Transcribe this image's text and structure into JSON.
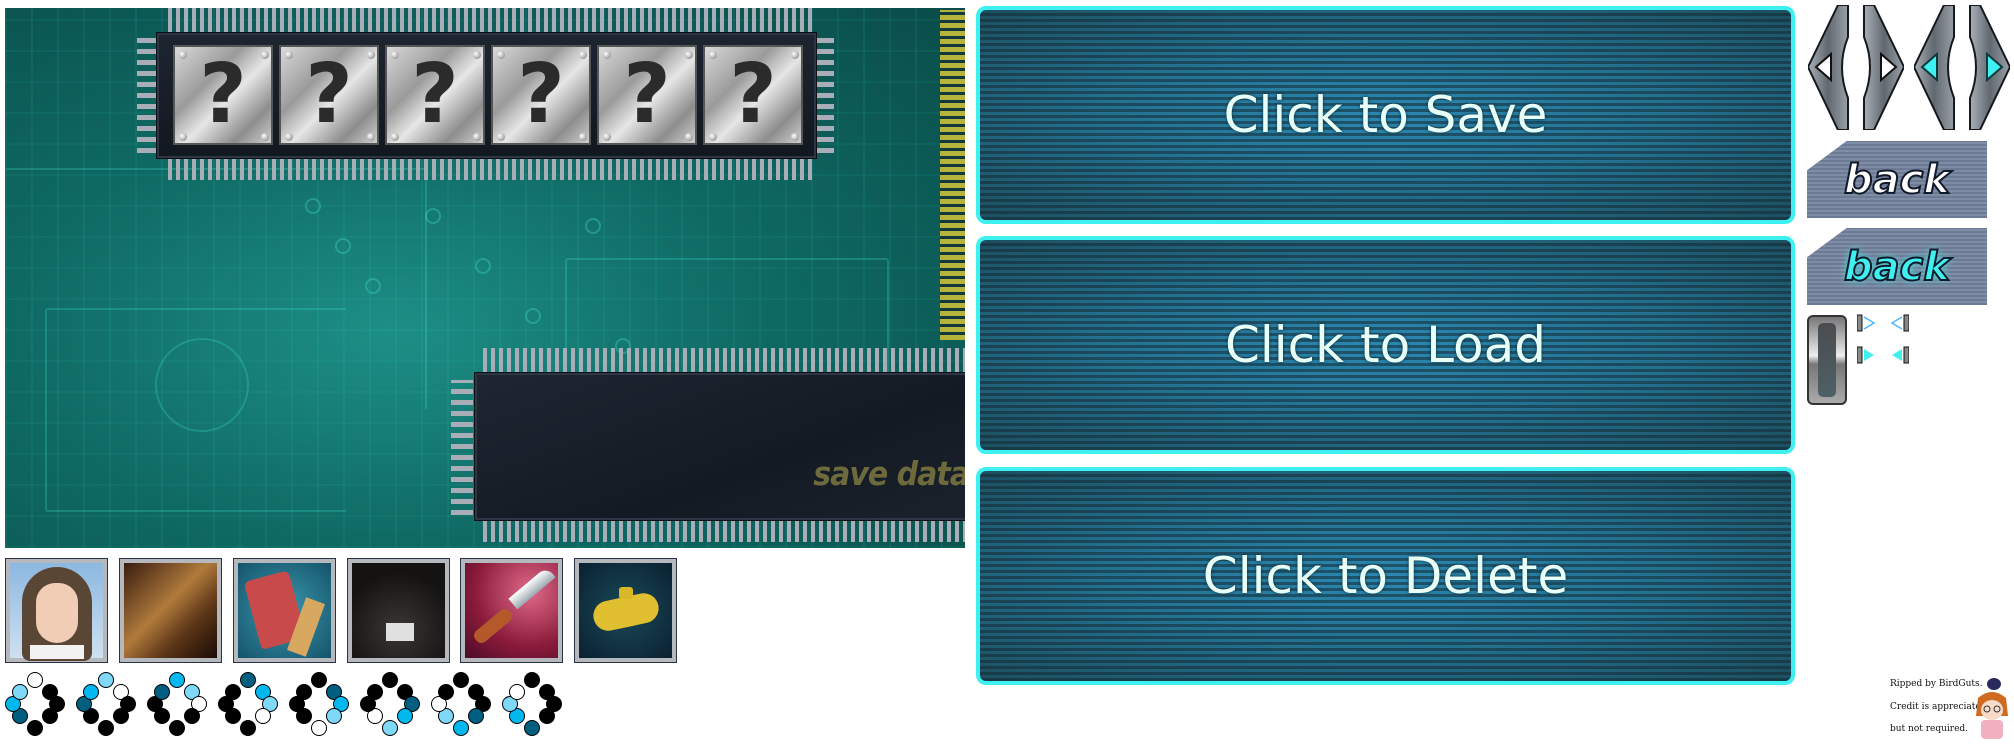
{
  "save_screen": {
    "slot_placeholders": [
      "?",
      "?",
      "?",
      "?",
      "?",
      "?"
    ],
    "title": "save data"
  },
  "actions": {
    "save": "Click to Save",
    "load": "Click to Load",
    "delete": "Click to Delete"
  },
  "navigation": {
    "arrows_normal_icon": "left-right-arrows-icon",
    "arrows_highlighted_icon": "left-right-arrows-highlighted-icon",
    "back_normal": "back",
    "back_highlighted": "back"
  },
  "colors": {
    "accent_cyan": "#3ff0f0",
    "button_blue": "#2b88b0",
    "circuit_teal": "#0f6a64",
    "back_highlight": "#3ff0f0"
  },
  "thumbnails": [
    {
      "icon": "girl-portrait"
    },
    {
      "icon": "coffin"
    },
    {
      "icon": "axe"
    },
    {
      "icon": "empty-safe"
    },
    {
      "icon": "knife"
    },
    {
      "icon": "yellow-submarine"
    }
  ],
  "loading_spinner": {
    "frames": 8,
    "palette": {
      "white": "#ffffff",
      "light": "#7fd8f8",
      "cyan": "#00b8f0",
      "dark": "#005f80",
      "black": "#000000"
    },
    "first_frame_clockwise_from_top": [
      "white",
      "black",
      "black",
      "black",
      "black",
      "dark",
      "cyan",
      "light"
    ]
  },
  "credits": {
    "line1": "Ripped by BirdGuts.",
    "line2": "Credit is appreciated,",
    "line3": "but not required."
  }
}
